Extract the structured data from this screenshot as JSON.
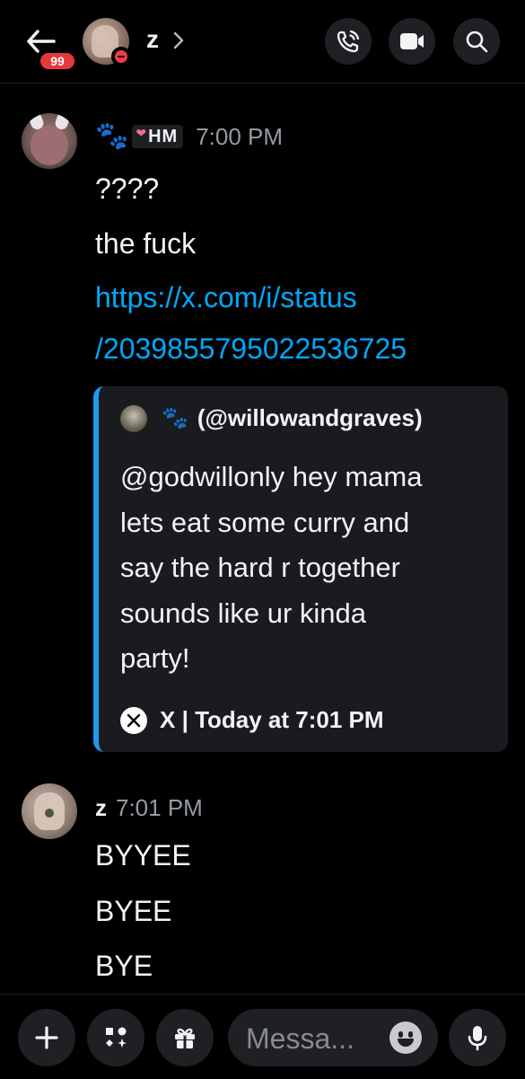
{
  "header": {
    "unread_badge": "99",
    "channel_name": "z",
    "chevron": ">",
    "icons": [
      "back-arrow-icon",
      "phone-call-icon",
      "video-camera-icon",
      "search-icon"
    ]
  },
  "messages": [
    {
      "author_emoji": "🐾",
      "role_tag_heart": "❤",
      "role_tag": "HM",
      "timestamp": "7:00 PM",
      "lines": [
        "????",
        "the fuck"
      ],
      "link_lines": [
        "https://x.com/i/status",
        "/2039855795022536725"
      ],
      "embed": {
        "author_emoji": "🐾",
        "author_handle": "(@willowandgraves)",
        "body_lines": [
          "@godwillonly hey mama",
          "lets eat some curry and",
          "say the hard r together",
          "sounds like ur kinda",
          "party!"
        ],
        "footer": "X | Today at 7:01 PM",
        "accent_color": "#1d9bf0"
      }
    },
    {
      "author": "z",
      "timestamp": "7:01 PM",
      "lines": [
        "BYYEE",
        "BYEE",
        "BYE"
      ]
    }
  ],
  "composer": {
    "placeholder": "Messa...",
    "icons": [
      "plus-icon",
      "apps-icon",
      "gift-icon",
      "emoji-icon",
      "microphone-icon"
    ]
  },
  "colors": {
    "background": "#000000",
    "link": "#00a8fc",
    "timestamp": "#949ba4",
    "badge": "#e5383b",
    "dnd": "#f23f43"
  }
}
